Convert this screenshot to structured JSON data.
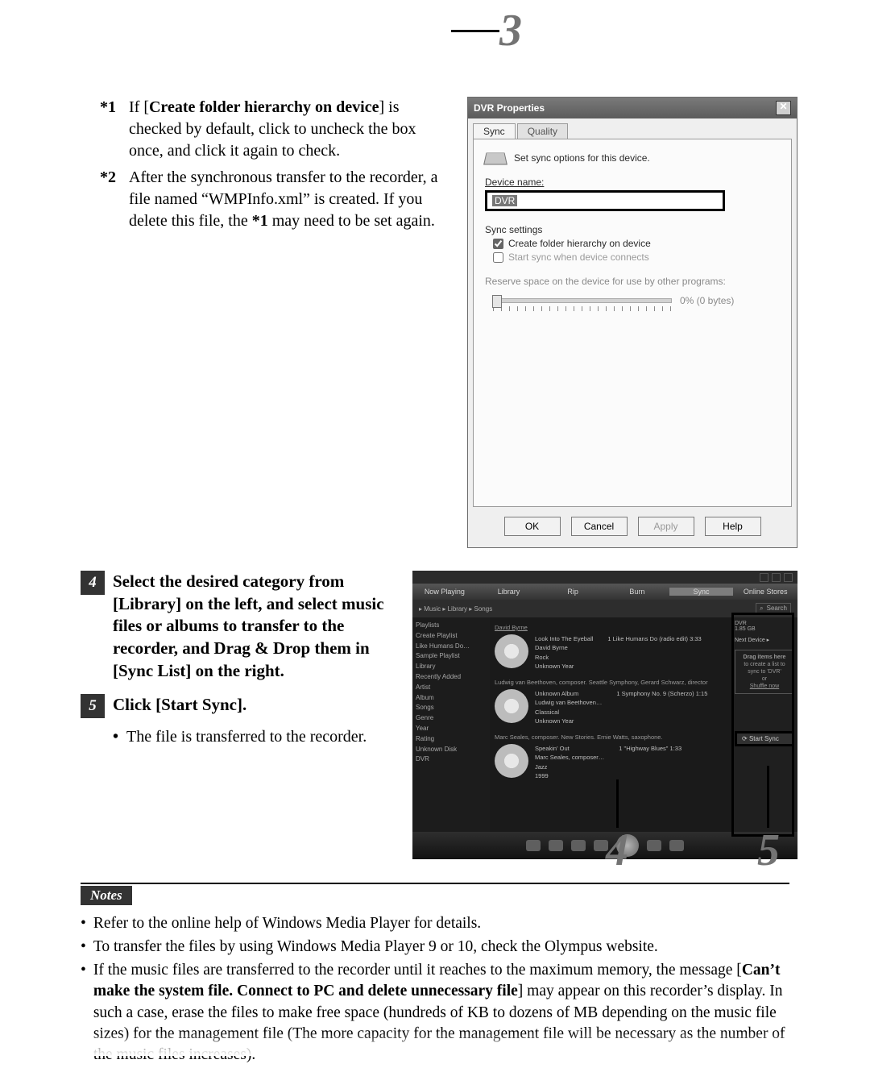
{
  "footnotes": {
    "f1_marker": "*1",
    "f1a": "If [",
    "f1b": "Create folder hierarchy on device",
    "f1c": "] is checked by default, click to uncheck the box once, and click it again to check.",
    "f2_marker": "*2",
    "f2a": "After the synchronous transfer to the recorder, a file named “WMPInfo.xml” is created. If you delete this file, the ",
    "f2b": "*1",
    "f2c": " may need to be set again."
  },
  "dialog": {
    "title": "DVR Properties",
    "close_glyph": "✕",
    "tab_sync": "Sync",
    "tab_quality": "Quality",
    "hint": "Set sync options for this device.",
    "device_name_lbl": "Device name:",
    "device_name_val": "DVR",
    "settings_lbl": "Sync settings",
    "chk1": "Create folder hierarchy on device",
    "chk2": "Start sync when device connects",
    "reserve_lbl": "Reserve space on the device for use by other programs:",
    "reserve_val": "0% (0 bytes)",
    "btn_ok": "OK",
    "btn_cancel": "Cancel",
    "btn_apply": "Apply",
    "btn_help": "Help"
  },
  "callouts": {
    "n3": "3",
    "n4": "4",
    "n5": "5"
  },
  "steps": {
    "s4_num": "4",
    "s4": "Select the desired category from [Library] on the left, and select music files or albums to transfer to the recorder, and Drag & Drop them in [Sync List] on the right.",
    "s5_num": "5",
    "s5": "Click [Start Sync].",
    "s5_sub": "The file is transferred to the recorder."
  },
  "wmp": {
    "app": "Windows Media Player",
    "tabs": [
      "Now Playing",
      "Library",
      "Rip",
      "Burn",
      "Sync",
      "Online Stores"
    ],
    "crumb": "▸ Music ▸ Library ▸ Songs",
    "search_placeholder": "Search",
    "side": [
      "Playlists",
      "  Create Playlist",
      "  Like Humans Do…",
      "  Sample Playlist",
      "Library",
      "  Recently Added",
      "  Artist",
      "  Album",
      "  Songs",
      "  Genre",
      "  Year",
      "  Rating",
      "Unknown Disk",
      "DVR"
    ],
    "col_artist": "David Byrne",
    "alb1": {
      "t1": "Look Into The Eyeball",
      "t2": "David Byrne",
      "t3": "Rock",
      "t4": "Unknown Year",
      "track": "1   Like Humans Do (radio edit)   3:33"
    },
    "sect1": "Ludwig van Beethoven, composer. Seattle Symphony, Gerard Schwarz, director",
    "alb2": {
      "t1": "Unknown Album",
      "t2": "Ludwig van Beethoven…",
      "t3": "Classical",
      "t4": "Unknown Year",
      "track": "1   Symphony No. 9 (Scherzo)   1:15"
    },
    "sect2": "Marc Seales, composer. New Stories. Ernie Watts, saxophone.",
    "alb3": {
      "t1": "Speakin' Out",
      "t2": "Marc Seales, composer…",
      "t3": "Jazz",
      "t4": "1999",
      "track": "1   \"Highway Blues\"   1:33"
    },
    "right_dev": "DVR",
    "right_cap": "1.85 GB",
    "right_link": "Next Device ▸",
    "drop_hdr": "Drag items here",
    "drop_body": "to create a list to sync to 'DVR'",
    "drop_or": "or",
    "shuffle": "Shuffle now",
    "start_sync": "Start Sync"
  },
  "notes": {
    "header": "Notes",
    "n1": "Refer to the online help of Windows Media Player for details.",
    "n2": "To transfer the files by using Windows Media Player 9 or 10, check the Olympus website.",
    "n3a": "If the music files are transferred to the recorder until it reaches to the maximum memory, the message [",
    "n3b": "Can’t make the system file. Connect to PC and delete unnecessary file",
    "n3c": "] may appear on this recorder’s display. In such a case, erase the files to make free space (hundreds of KB to dozens of MB depending on the music file sizes) for the management file (The more capacity for the management file will be necessary as the number of the music files increases)."
  }
}
